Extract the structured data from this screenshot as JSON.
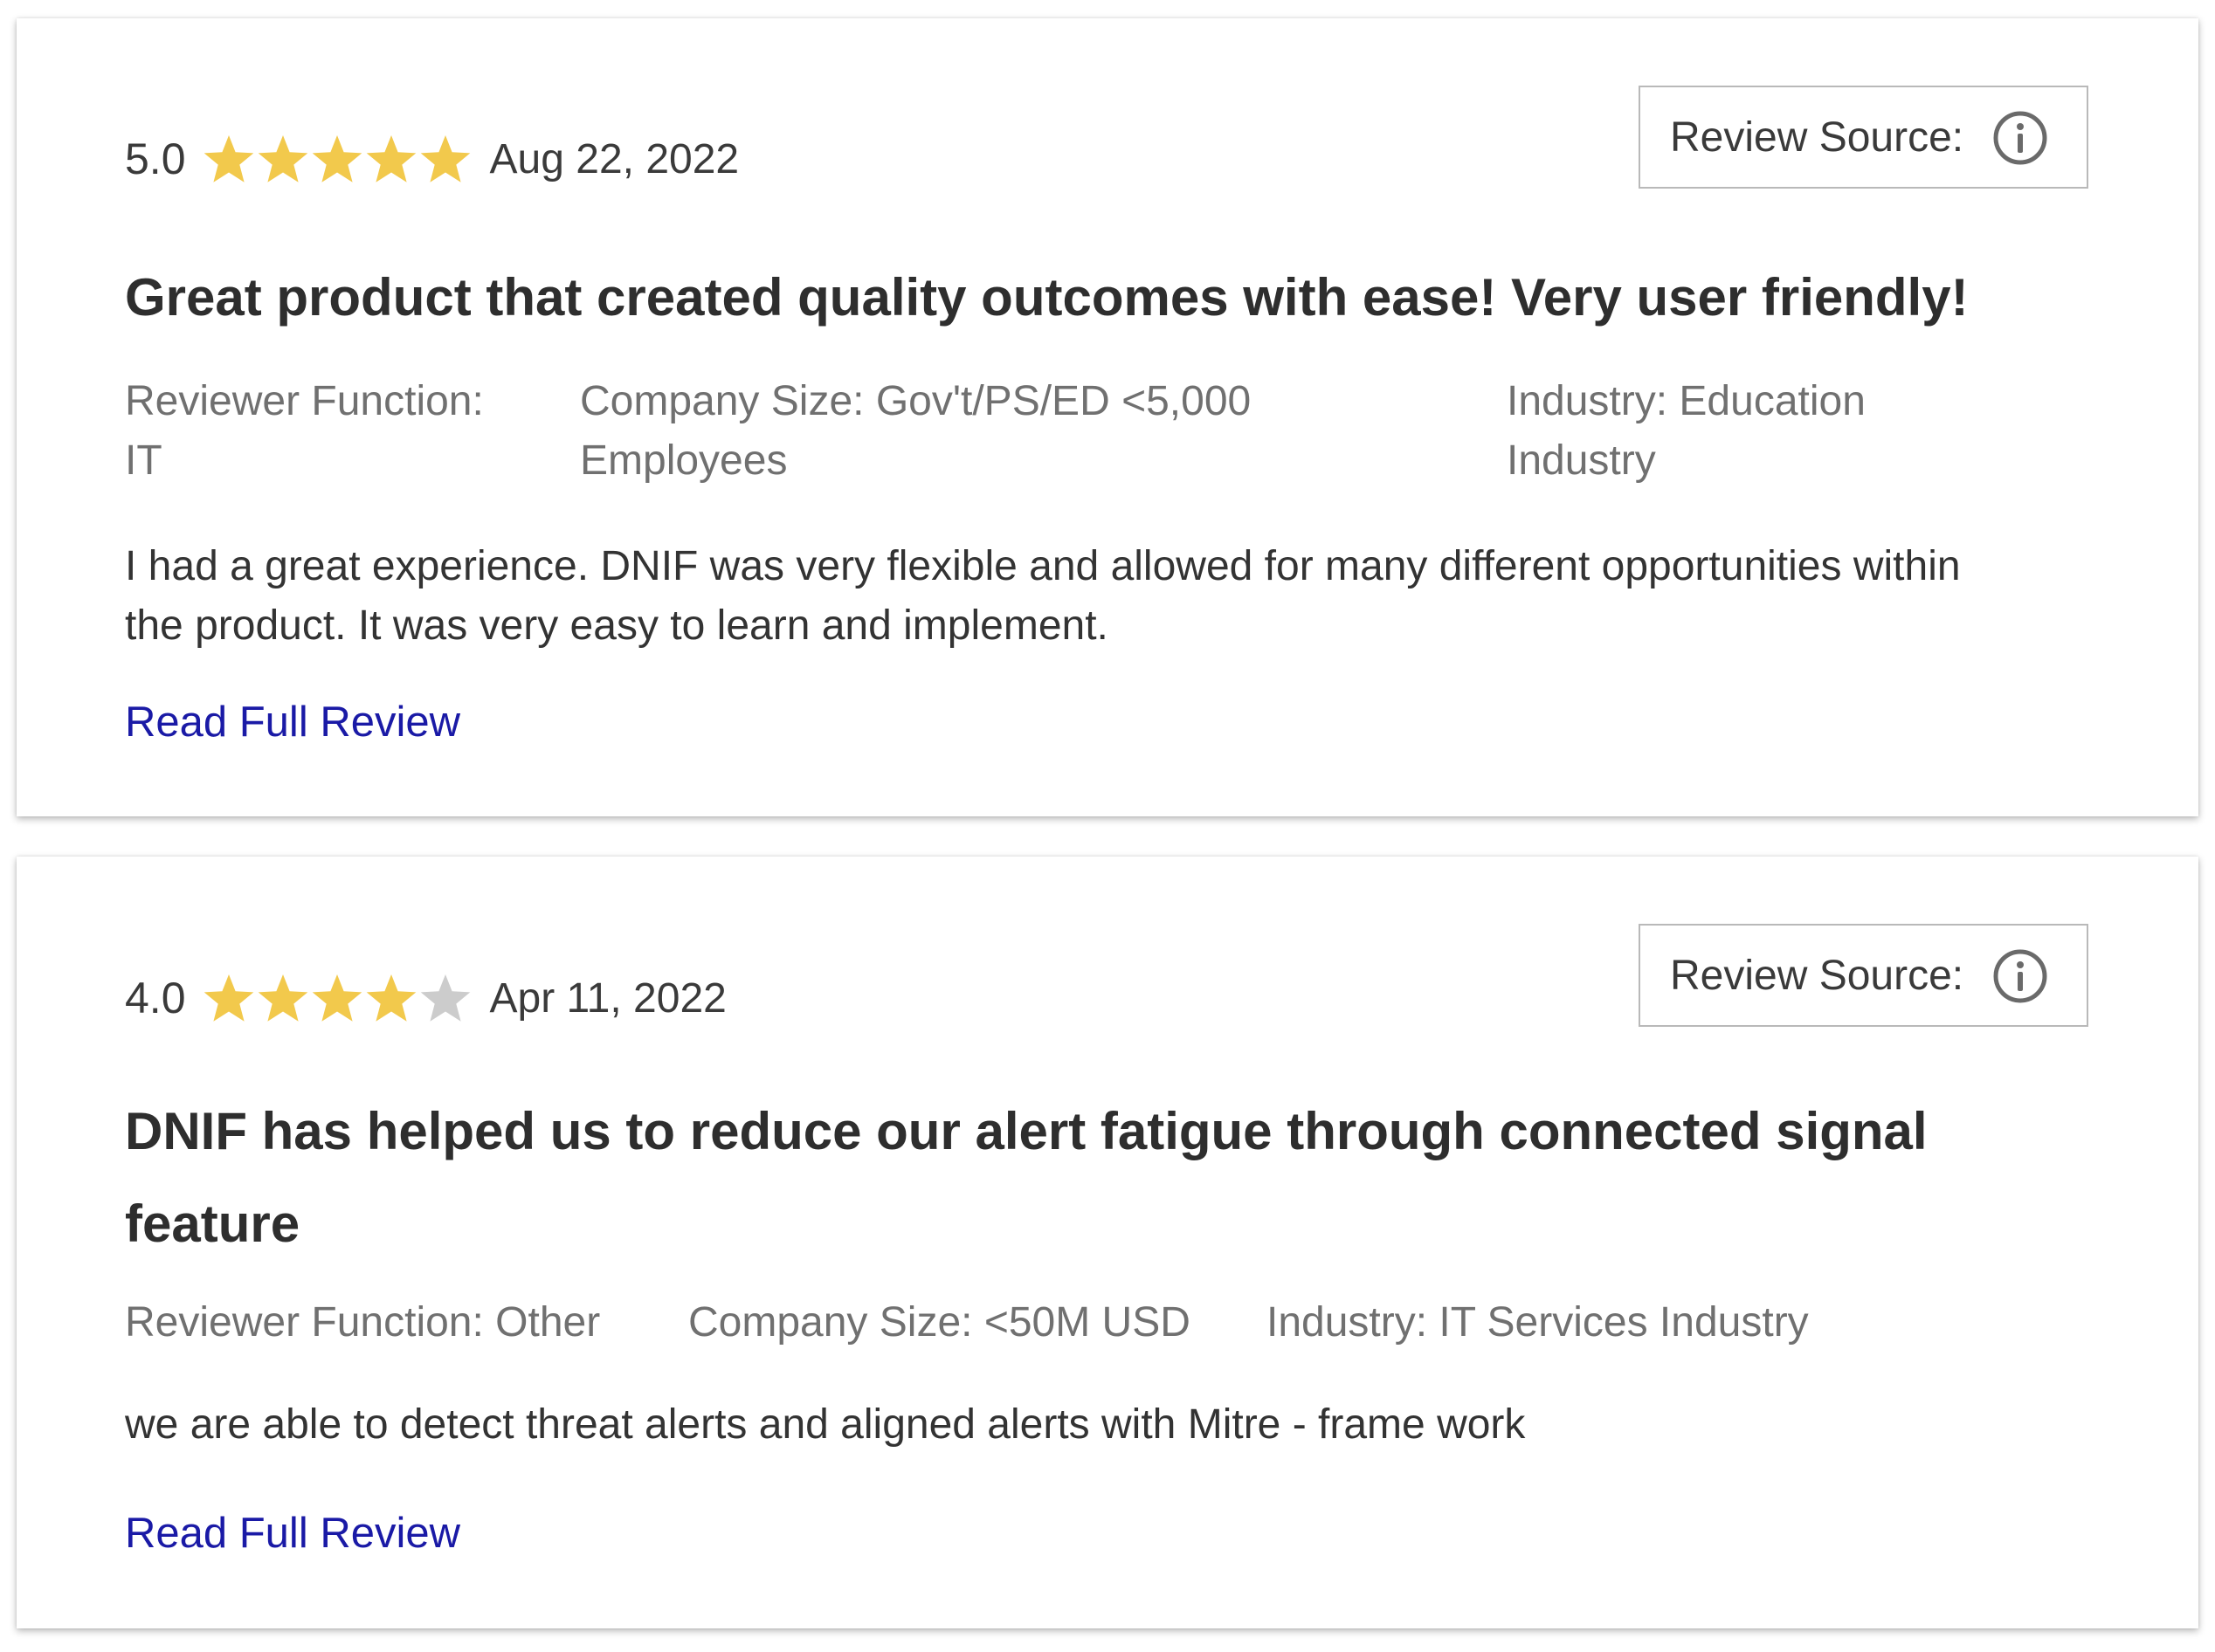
{
  "reviews": [
    {
      "rating": "5.0",
      "stars_filled": 5,
      "stars_total": 5,
      "date": "Aug 22, 2022",
      "source_label": "Review Source:",
      "title": "Great product that created quality outcomes with ease! Very user friendly!",
      "reviewer_function": "Reviewer Function: IT",
      "company_size": "Company Size: Gov't/PS/ED <5,000 Employees",
      "industry": "Industry: Education Industry",
      "body": "I had a great experience. DNIF was very flexible and allowed for many different opportunities within the product. It was very easy to learn and implement.",
      "read_more": "Read Full Review"
    },
    {
      "rating": "4.0",
      "stars_filled": 4,
      "stars_total": 5,
      "date": "Apr 11, 2022",
      "source_label": "Review Source:",
      "title": "DNIF has helped us to reduce our alert fatigue through connected signal feature",
      "reviewer_function": "Reviewer Function: Other",
      "company_size": "Company Size: <50M USD",
      "industry": "Industry: IT Services Industry",
      "body": "we are able to detect threat alerts and aligned alerts with Mitre - frame work",
      "read_more": "Read Full Review"
    }
  ],
  "colors": {
    "star_filled": "#F2C94C",
    "star_empty": "#CCCCCC",
    "link": "#1A1AA6",
    "meta_text": "#707070"
  },
  "icons": {
    "star": "star-icon",
    "info": "info-icon"
  }
}
